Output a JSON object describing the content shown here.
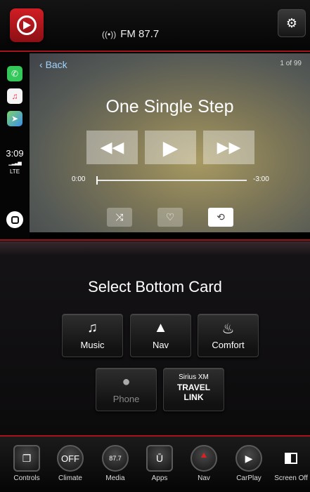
{
  "header": {
    "radio_label": "FM 87.7",
    "settings_icon": "⚙"
  },
  "carplay_sidebar": {
    "time": "3:09",
    "signal": "▁▂▃▅",
    "network": "LTE"
  },
  "now_playing": {
    "back_label": "Back",
    "track_counter": "1 of 99",
    "title": "One Single Step",
    "elapsed": "0:00",
    "remaining": "-3:00",
    "progress_fraction": 0.0
  },
  "card_selector": {
    "title": "Select Bottom Card",
    "cards": {
      "music": "Music",
      "nav": "Nav",
      "comfort": "Comfort",
      "phone": "Phone",
      "siriusxm_line1": "Sirius XM",
      "siriusxm_line2": "TRAVEL",
      "siriusxm_line3": "LINK"
    }
  },
  "dock": {
    "controls": "Controls",
    "climate": "Climate",
    "climate_icon_text": "OFF",
    "media": "Media",
    "media_icon_text": "87.7",
    "apps": "Apps",
    "apps_icon_text": "Ū",
    "nav": "Nav",
    "carplay": "CarPlay",
    "screen_off": "Screen Off"
  },
  "colors": {
    "accent_red": "#a3151b",
    "link_blue": "#9fd4ff"
  }
}
